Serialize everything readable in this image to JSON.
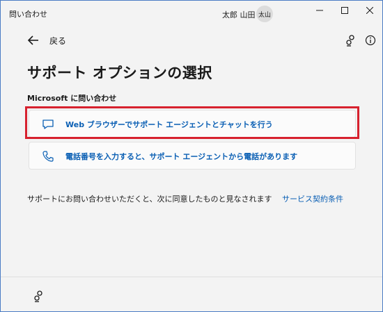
{
  "window": {
    "title": "問い合わせ",
    "user_name": "太郎 山田",
    "avatar_text": "太山",
    "controls": [
      "minimize-icon",
      "maximize-icon",
      "close-icon"
    ]
  },
  "nav": {
    "back_label": "戻る",
    "back_icon": "arrow-left-icon",
    "right_icons": [
      "settings-icon",
      "info-icon"
    ]
  },
  "page": {
    "title": "サポート オプションの選択",
    "section_label": "Microsoft に問い合わせ"
  },
  "options": [
    {
      "icon": "chat-bubble-icon",
      "label": "Web ブラウザーでサポート エージェントとチャットを行う",
      "highlighted": true
    },
    {
      "icon": "phone-icon",
      "label": "電話番号を入力すると、サポート エージェントから電話があります",
      "highlighted": false
    }
  ],
  "consent": {
    "text": "サポートにお問い合わせいただくと、次に同意したものと見なされます",
    "link_label": "サービス契約条件"
  },
  "footer": {
    "icon": "settings-icon"
  },
  "colors": {
    "accent": "#0a5fb4",
    "highlight_border": "#d7212e",
    "background": "#f3f3f3",
    "card_background": "#fbfbfb"
  }
}
